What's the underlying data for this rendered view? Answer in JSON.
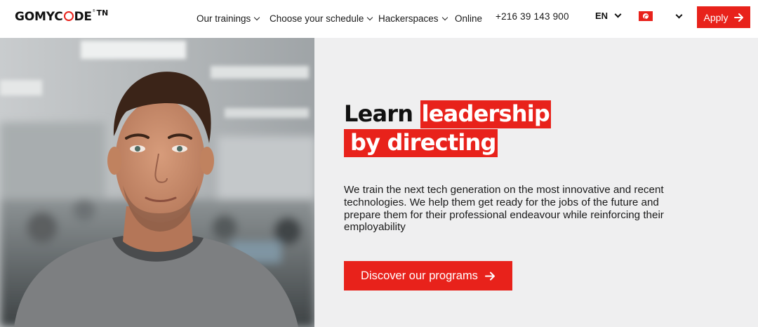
{
  "header": {
    "logo_text": "GOMYCODE",
    "logo_registered": "®",
    "logo_country": "TN",
    "nav": [
      {
        "label": "Our trainings",
        "has_dropdown": true
      },
      {
        "label": "Choose your schedule",
        "has_dropdown": true
      },
      {
        "label": "Hackerspaces",
        "has_dropdown": true
      },
      {
        "label": "Online",
        "has_dropdown": false
      }
    ],
    "phone": "+216 39 143 900",
    "language": "EN",
    "country_flag": "tunisia-flag-icon",
    "apply_label": "Apply"
  },
  "hero": {
    "headline": {
      "plain": "Learn",
      "highlight_1": "leadership",
      "highlight_2": "by directing"
    },
    "description": "We train the next tech generation on the most innovative and recent technologies. We help them get ready for the jobs of the future and prepare them for their professional endeavour while reinforcing their employability",
    "cta_label": "Discover our programs"
  },
  "colors": {
    "accent": "#e8221b",
    "hero_background": "#efeff0",
    "text": "#111111"
  },
  "icons": {
    "nav_caret": "chevron-down-icon",
    "button_arrow": "arrow-right-icon"
  }
}
